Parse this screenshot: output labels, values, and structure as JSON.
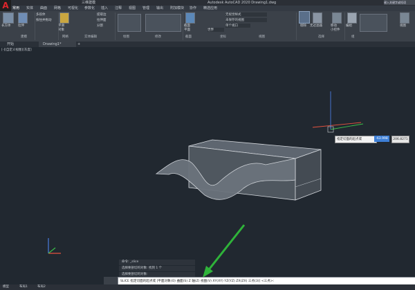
{
  "app": {
    "logo_letter": "A",
    "quick_access": "三维建模",
    "title": "Autodesk AutoCAD 2020   Drawing1.dwg",
    "user_box": "键入关键字或短语"
  },
  "ribbon_tabs": [
    "常用",
    "实体",
    "曲面",
    "网格",
    "可视化",
    "参数化",
    "插入",
    "注释",
    "视图",
    "管理",
    "输出",
    "附加模块",
    "协作",
    "精选应用"
  ],
  "ribbon": {
    "buttons": {
      "box": "长方体",
      "extrude": "拉伸",
      "smooth_object": "平滑\n对象",
      "section_plane": "截面\n平面",
      "culling": "剔除",
      "no_filter": "无过滤器",
      "move_gizmo": "移动\n小控件",
      "group": "编组",
      "view": "视图"
    },
    "small": [
      "多段体",
      "按住并拖动",
      "提取边",
      "拉伸面",
      "分割",
      "未保存的视图",
      "世界",
      "单个视口",
      "无视觉样式"
    ],
    "panels": [
      "建模",
      "网格",
      "实体编辑",
      "绘图",
      "修改",
      "截面",
      "坐标",
      "视图",
      "选择",
      "组"
    ]
  },
  "doc_tabs": [
    "开始",
    "Drawing1*"
  ],
  "viewport_label": "[-][自定义视图][灰度]",
  "dynamic_input": {
    "prompt": "指定切面的起点或",
    "x": "-63.998",
    "y": "206.8271"
  },
  "command_history": [
    "命令: _slice",
    "选择要剖切的对象: 找到 1 个",
    "选择要剖切的对象:"
  ],
  "command_line": "SLICE 指定切面的起点或 [平面对象(O) 曲面(S) Z 轴(Z) 视图(V) XY(XY) YZ(YZ) ZX(ZX) 三点(3)] <三点>:",
  "status_tabs": [
    "模型",
    "布局1",
    "布局2"
  ],
  "colors": {
    "background": "#212830",
    "arrow": "#2fb33a",
    "cursor_x": "#e8533f",
    "cursor_y": "#3bbf4a",
    "cursor_z": "#4a7be0"
  }
}
